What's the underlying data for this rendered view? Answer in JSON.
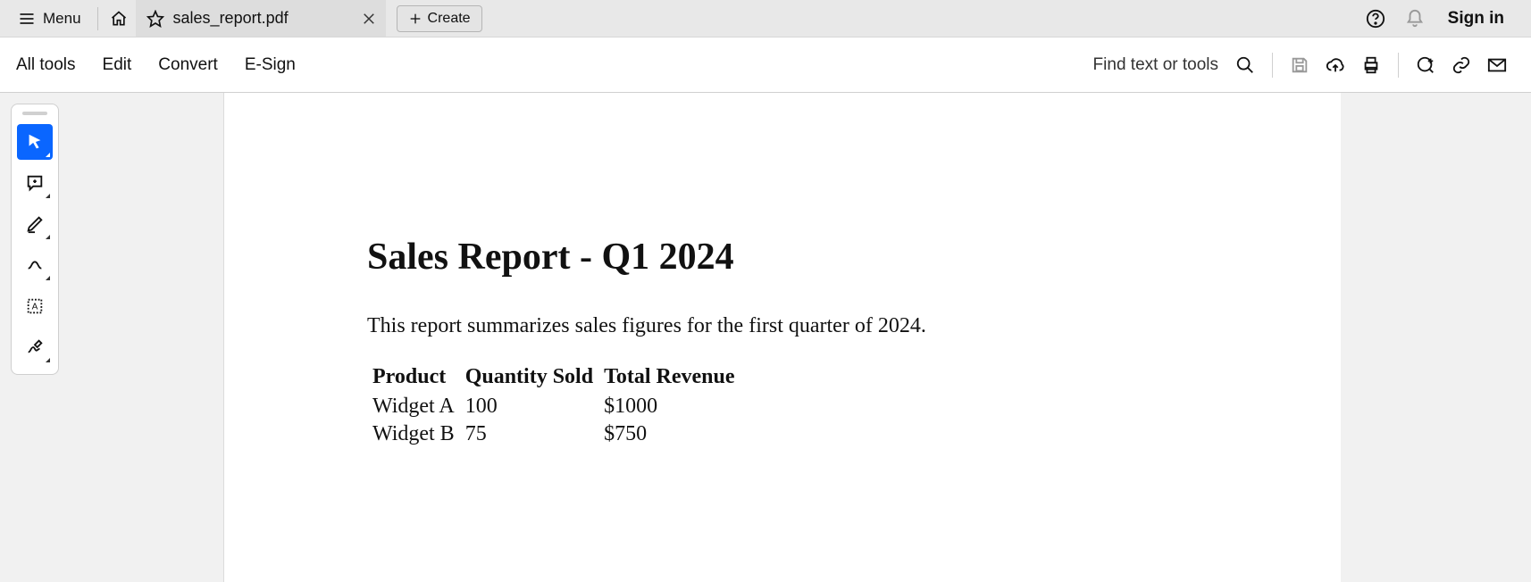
{
  "topbar": {
    "menu_label": "Menu",
    "tab_title": "sales_report.pdf",
    "create_label": "Create",
    "signin_label": "Sign in"
  },
  "toolbar": {
    "items": [
      "All tools",
      "Edit",
      "Convert",
      "E-Sign"
    ],
    "find_label": "Find text or tools"
  },
  "side_tools": {
    "items": [
      "select",
      "comment",
      "highlight",
      "draw",
      "text-select",
      "sign"
    ]
  },
  "document": {
    "title": "Sales Report - Q1 2024",
    "paragraph": "This report summarizes sales figures for the first quarter of 2024.",
    "table": {
      "headers": [
        "Product",
        "Quantity Sold",
        "Total Revenue"
      ],
      "rows": [
        [
          "Widget A",
          "100",
          "$1000"
        ],
        [
          "Widget B",
          "75",
          "$750"
        ]
      ]
    }
  }
}
